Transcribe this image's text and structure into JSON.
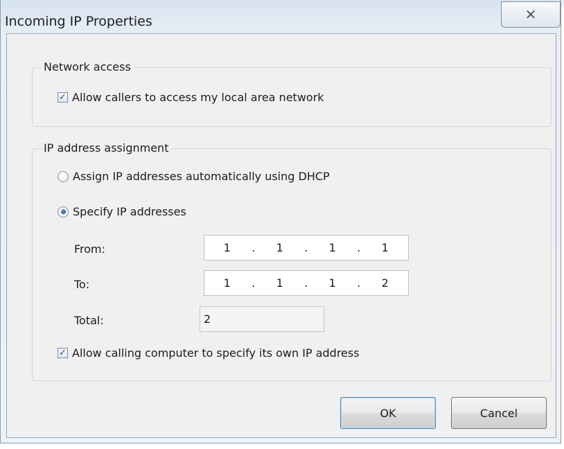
{
  "window": {
    "title": "Incoming IP Properties",
    "close_icon": "close-icon"
  },
  "network_access": {
    "legend": "Network access",
    "allow_lan": {
      "label": "Allow callers to access my local area network",
      "checked": true
    }
  },
  "ip_assignment": {
    "legend": "IP address assignment",
    "dhcp_option": {
      "label": "Assign IP addresses automatically using DHCP",
      "selected": false
    },
    "specify_option": {
      "label": "Specify IP addresses",
      "selected": true
    },
    "from": {
      "label": "From:",
      "octets": [
        "1",
        "1",
        "1",
        "1"
      ]
    },
    "to": {
      "label": "To:",
      "octets": [
        "1",
        "1",
        "1",
        "2"
      ]
    },
    "total": {
      "label": "Total:",
      "value": "2"
    },
    "allow_own_ip": {
      "label": "Allow calling computer to specify its own IP address",
      "checked": true
    }
  },
  "buttons": {
    "ok": "OK",
    "cancel": "Cancel"
  },
  "glyphs": {
    "dot": ".",
    "check": "✓",
    "close": "✕"
  }
}
